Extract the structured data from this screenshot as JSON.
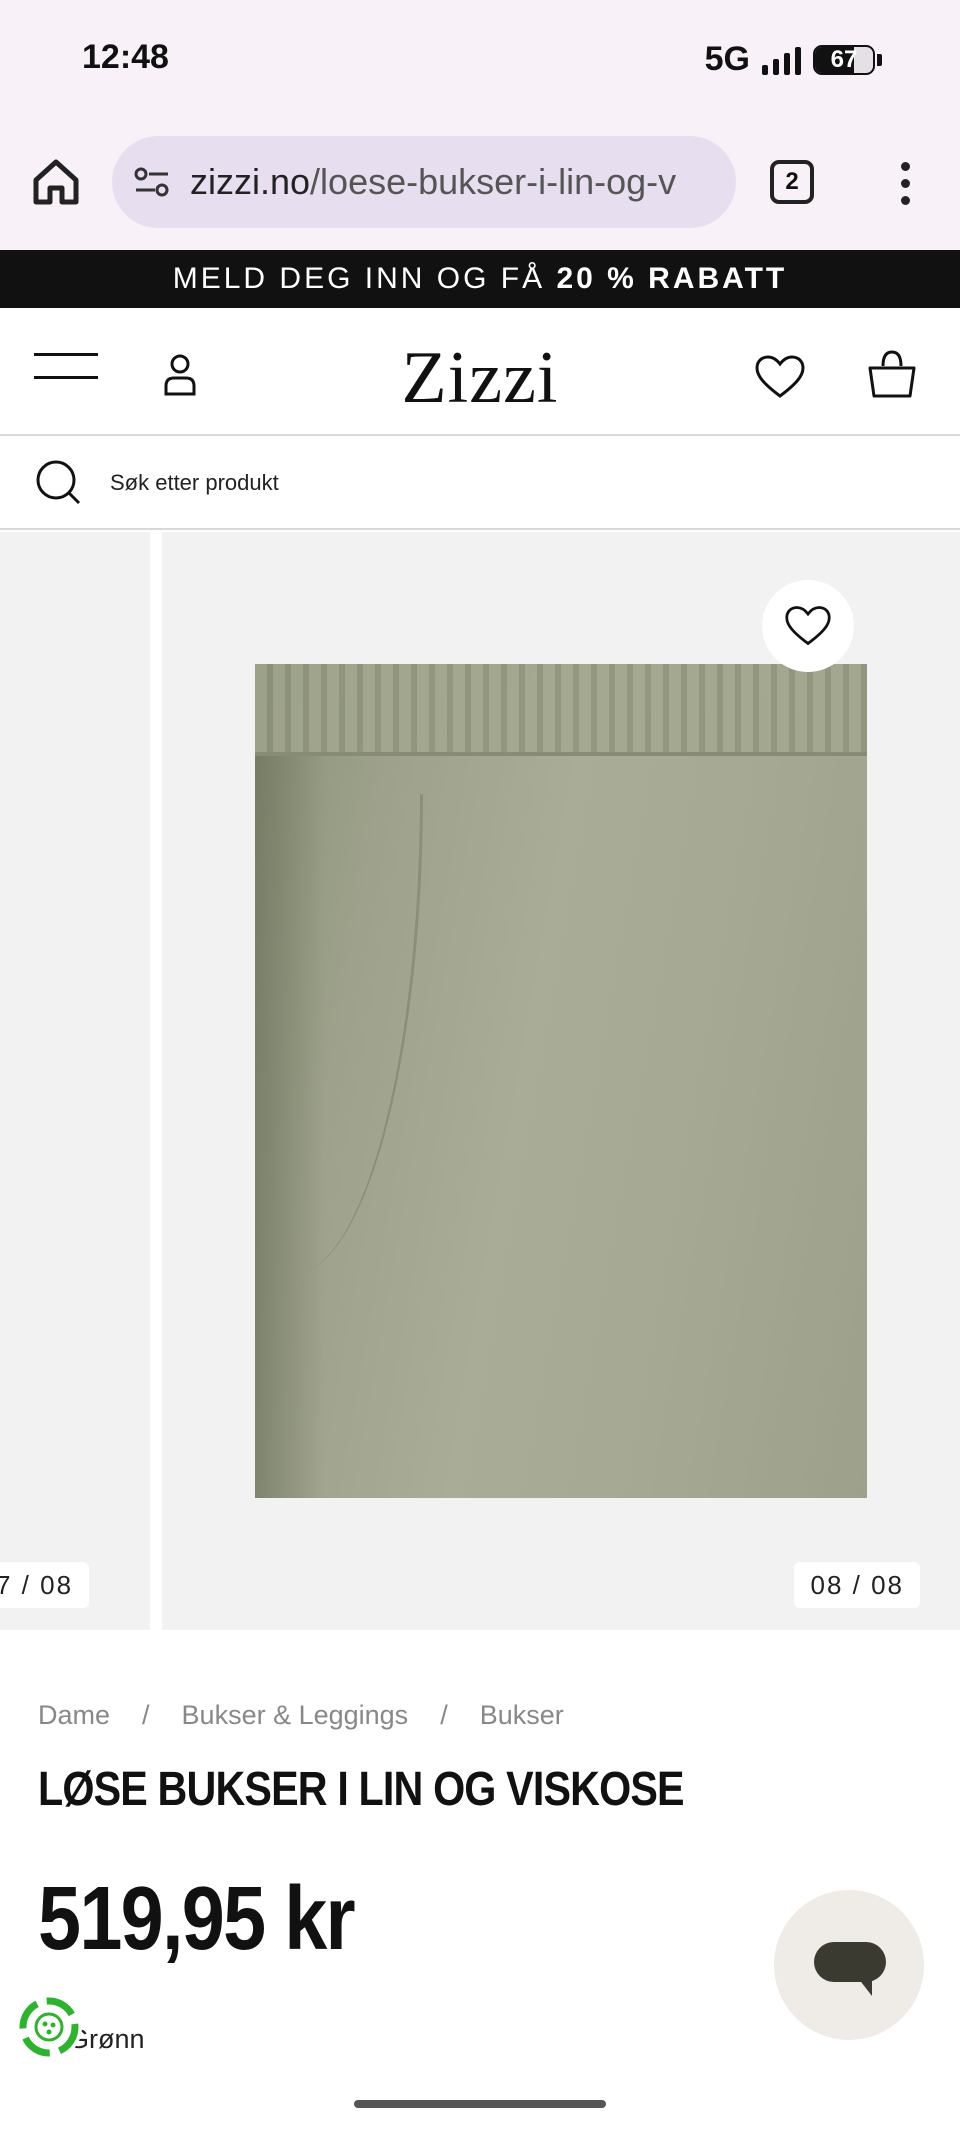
{
  "status_bar": {
    "time": "12:48",
    "network": "5G",
    "battery": "67",
    "battery_level": 0.67
  },
  "browser": {
    "url_domain": "zizzi.no",
    "url_path": "/loese-bukser-i-lin-og-v",
    "tab_count": "2"
  },
  "promo": {
    "text": "MELD DEG INN OG FÅ ",
    "highlight": "20 % RABATT"
  },
  "header": {
    "logo": "Zizzi"
  },
  "search": {
    "placeholder": "Søk etter produkt"
  },
  "gallery": {
    "prev_counter": "7 / 08",
    "current_counter": "08 / 08"
  },
  "product": {
    "breadcrumbs": [
      "Dame",
      "Bukser & Leggings",
      "Bukser"
    ],
    "breadcrumb_separator": "/",
    "title": "LØSE BUKSER I LIN OG VISKOSE",
    "price": "519,95 kr",
    "color_text": "e: Grønn"
  },
  "colors": {
    "status_bg": "#f8f1f8",
    "url_bg": "#e7dff0",
    "promo_bg": "#111111",
    "gallery_bg": "#f2f2f2",
    "eco_green": "#2db32d"
  }
}
